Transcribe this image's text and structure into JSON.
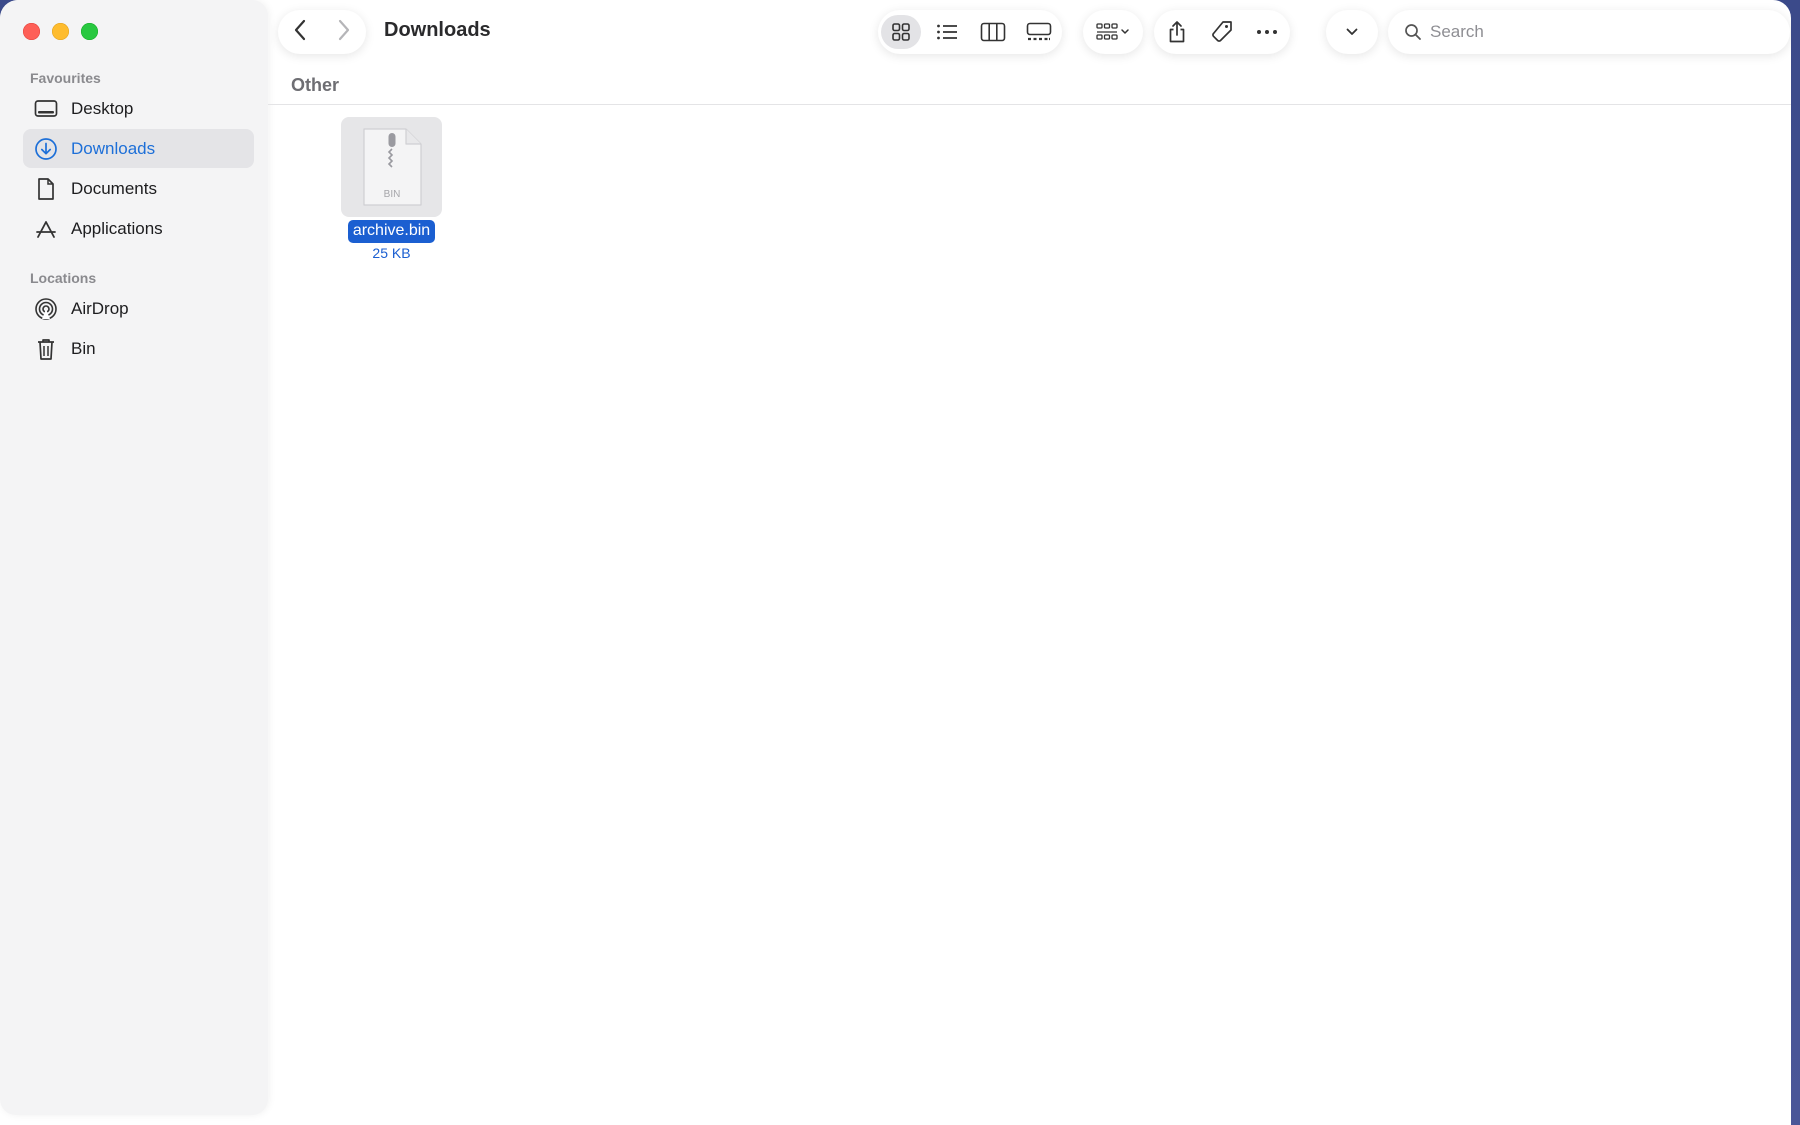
{
  "window": {
    "title": "Downloads"
  },
  "sidebar": {
    "sections": [
      {
        "label": "Favourites",
        "items": [
          {
            "label": "Desktop",
            "icon": "desktop-icon"
          },
          {
            "label": "Downloads",
            "icon": "download-icon",
            "active": true
          },
          {
            "label": "Documents",
            "icon": "document-icon"
          },
          {
            "label": "Applications",
            "icon": "applications-icon"
          }
        ]
      },
      {
        "label": "Locations",
        "items": [
          {
            "label": "AirDrop",
            "icon": "airdrop-icon"
          },
          {
            "label": "Bin",
            "icon": "trash-icon"
          }
        ]
      }
    ]
  },
  "toolbar": {
    "view_modes": [
      "icon-view-icon",
      "list-view-icon",
      "column-view-icon",
      "gallery-view-icon"
    ],
    "active_view": "icon-view-icon",
    "search": {
      "placeholder": "Search"
    }
  },
  "content": {
    "group_label": "Other",
    "files": [
      {
        "name": "archive.bin",
        "size": "25 KB",
        "type_label": "BIN",
        "selected": true
      }
    ]
  },
  "colors": {
    "accent": "#1d6fd8",
    "selection": "#1b5fd1",
    "close": "#fe5f57",
    "minimize": "#febc2e",
    "maximize": "#28c840"
  }
}
